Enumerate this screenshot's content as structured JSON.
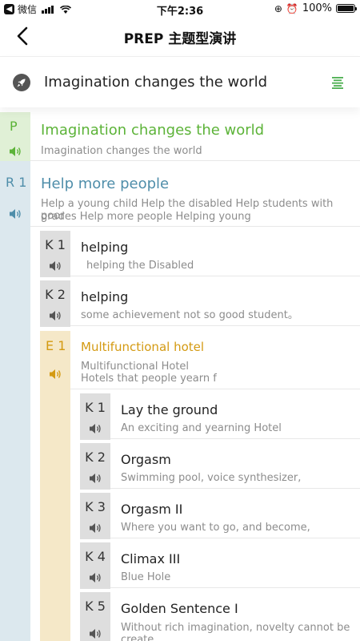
{
  "status_bar": {
    "carrier": "微信",
    "time": "下午2:36",
    "battery": "100%",
    "battery_level": 1.0
  },
  "nav": {
    "title": "PREP 主题型演讲"
  },
  "topic": {
    "title": "Imagination changes the world"
  },
  "outline": {
    "p": {
      "label": "P",
      "title": "Imagination changes the world",
      "subtitle": "Imagination changes the world"
    },
    "r1": {
      "label": "R 1",
      "title": "Help more people",
      "subtitle_line1": "Help a young child Help the disabled Help students with poor",
      "subtitle_line2": "grades Help more people Helping young",
      "keys": [
        {
          "label": "K 1",
          "title": "helping",
          "subtitle": "helping the Disabled"
        },
        {
          "label": "K 2",
          "title": "helping",
          "subtitle": "some achievement not so good student。"
        }
      ]
    },
    "e1": {
      "label": "E 1",
      "title": "Multifunctional hotel",
      "subtitle_line1": "Multifunctional Hotel",
      "subtitle_line2": "Hotels that people yearn f",
      "keys": [
        {
          "label": "K 1",
          "title": "Lay the ground",
          "subtitle": "An exciting and yearning Hotel"
        },
        {
          "label": "K 2",
          "title": "Orgasm",
          "subtitle": "Swimming pool, voice synthesizer,"
        },
        {
          "label": "K 3",
          "title": "Orgasm II",
          "subtitle": "Where you want to go, and become,"
        },
        {
          "label": "K 4",
          "title": "Climax III",
          "subtitle": "Blue Hole"
        },
        {
          "label": "K 5",
          "title": "Golden Sentence I",
          "subtitle_line1": "Without rich imagination, novelty cannot be",
          "subtitle_line2": "create"
        }
      ]
    }
  },
  "colors": {
    "p_green": "#5cb338",
    "r_blue": "#4f8eaa",
    "e_orange": "#d49a12",
    "speaker_gray": "#555555"
  }
}
